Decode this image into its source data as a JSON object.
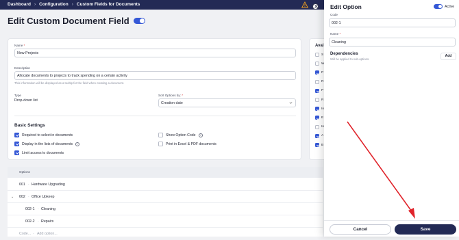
{
  "breadcrumb": [
    "Dashboard",
    "Configuration",
    "Custom Fields for Documents"
  ],
  "page_title": "Edit Custom Document Field",
  "form": {
    "name_label": "Name",
    "name_required": "*",
    "name_value": "New Projects",
    "description_label": "Description",
    "description_value": "Allocate documents to projects to track spending on a certain activity",
    "description_hint": "This information will be displayed as a tooltip for the field when creating a document.",
    "type_label": "Type",
    "type_value": "Drop-down list",
    "sort_label": "Sort Options by:",
    "sort_required": "*",
    "sort_value": "Creation date"
  },
  "basic_settings": {
    "title": "Basic Settings",
    "items": [
      {
        "label": "Required to select in documents",
        "checked": true
      },
      {
        "label": "Display in the lists of documents",
        "checked": true
      },
      {
        "label": "Limit access to documents",
        "checked": true
      },
      {
        "label": "Show Option Code",
        "checked": false
      },
      {
        "label": "Print in Excel & PDF documents",
        "checked": false
      }
    ]
  },
  "options_table": {
    "header": "Options",
    "rows": [
      {
        "code": "001",
        "name": "Hardware Upgrading"
      },
      {
        "code": "002",
        "name": "Office Upkeep"
      },
      {
        "code": "002-1",
        "name": "Cleaning"
      },
      {
        "code": "002-2",
        "name": "Repairs"
      }
    ],
    "code_placeholder": "Code...",
    "add_placeholder": "Add option..."
  },
  "available_panel": {
    "title": "Avail",
    "items": [
      {
        "label": "S",
        "checked": false
      },
      {
        "label": "W",
        "checked": false
      },
      {
        "label": "P",
        "checked": true
      },
      {
        "label": "R",
        "checked": false
      },
      {
        "label": "P",
        "checked": true
      },
      {
        "label": "R",
        "checked": false
      },
      {
        "label": "In",
        "checked": true
      },
      {
        "label": "E",
        "checked": true
      },
      {
        "label": "In",
        "checked": false
      },
      {
        "label": "A",
        "checked": true
      },
      {
        "label": "B",
        "checked": true
      }
    ]
  },
  "drawer": {
    "title": "Edit Option",
    "active_label": "Active",
    "code_label": "Code",
    "code_value": "002-1",
    "name_label": "Name",
    "name_required": "*",
    "name_value": "Cleaning",
    "dependencies_title": "Dependencies",
    "dependencies_sub": "Will be applied to sub-options.",
    "add_label": "Add",
    "cancel_label": "Cancel",
    "save_label": "Save"
  },
  "colors": {
    "nav": "#232a55",
    "accent": "#3558d6",
    "annotation_arrow": "#e0242b"
  }
}
